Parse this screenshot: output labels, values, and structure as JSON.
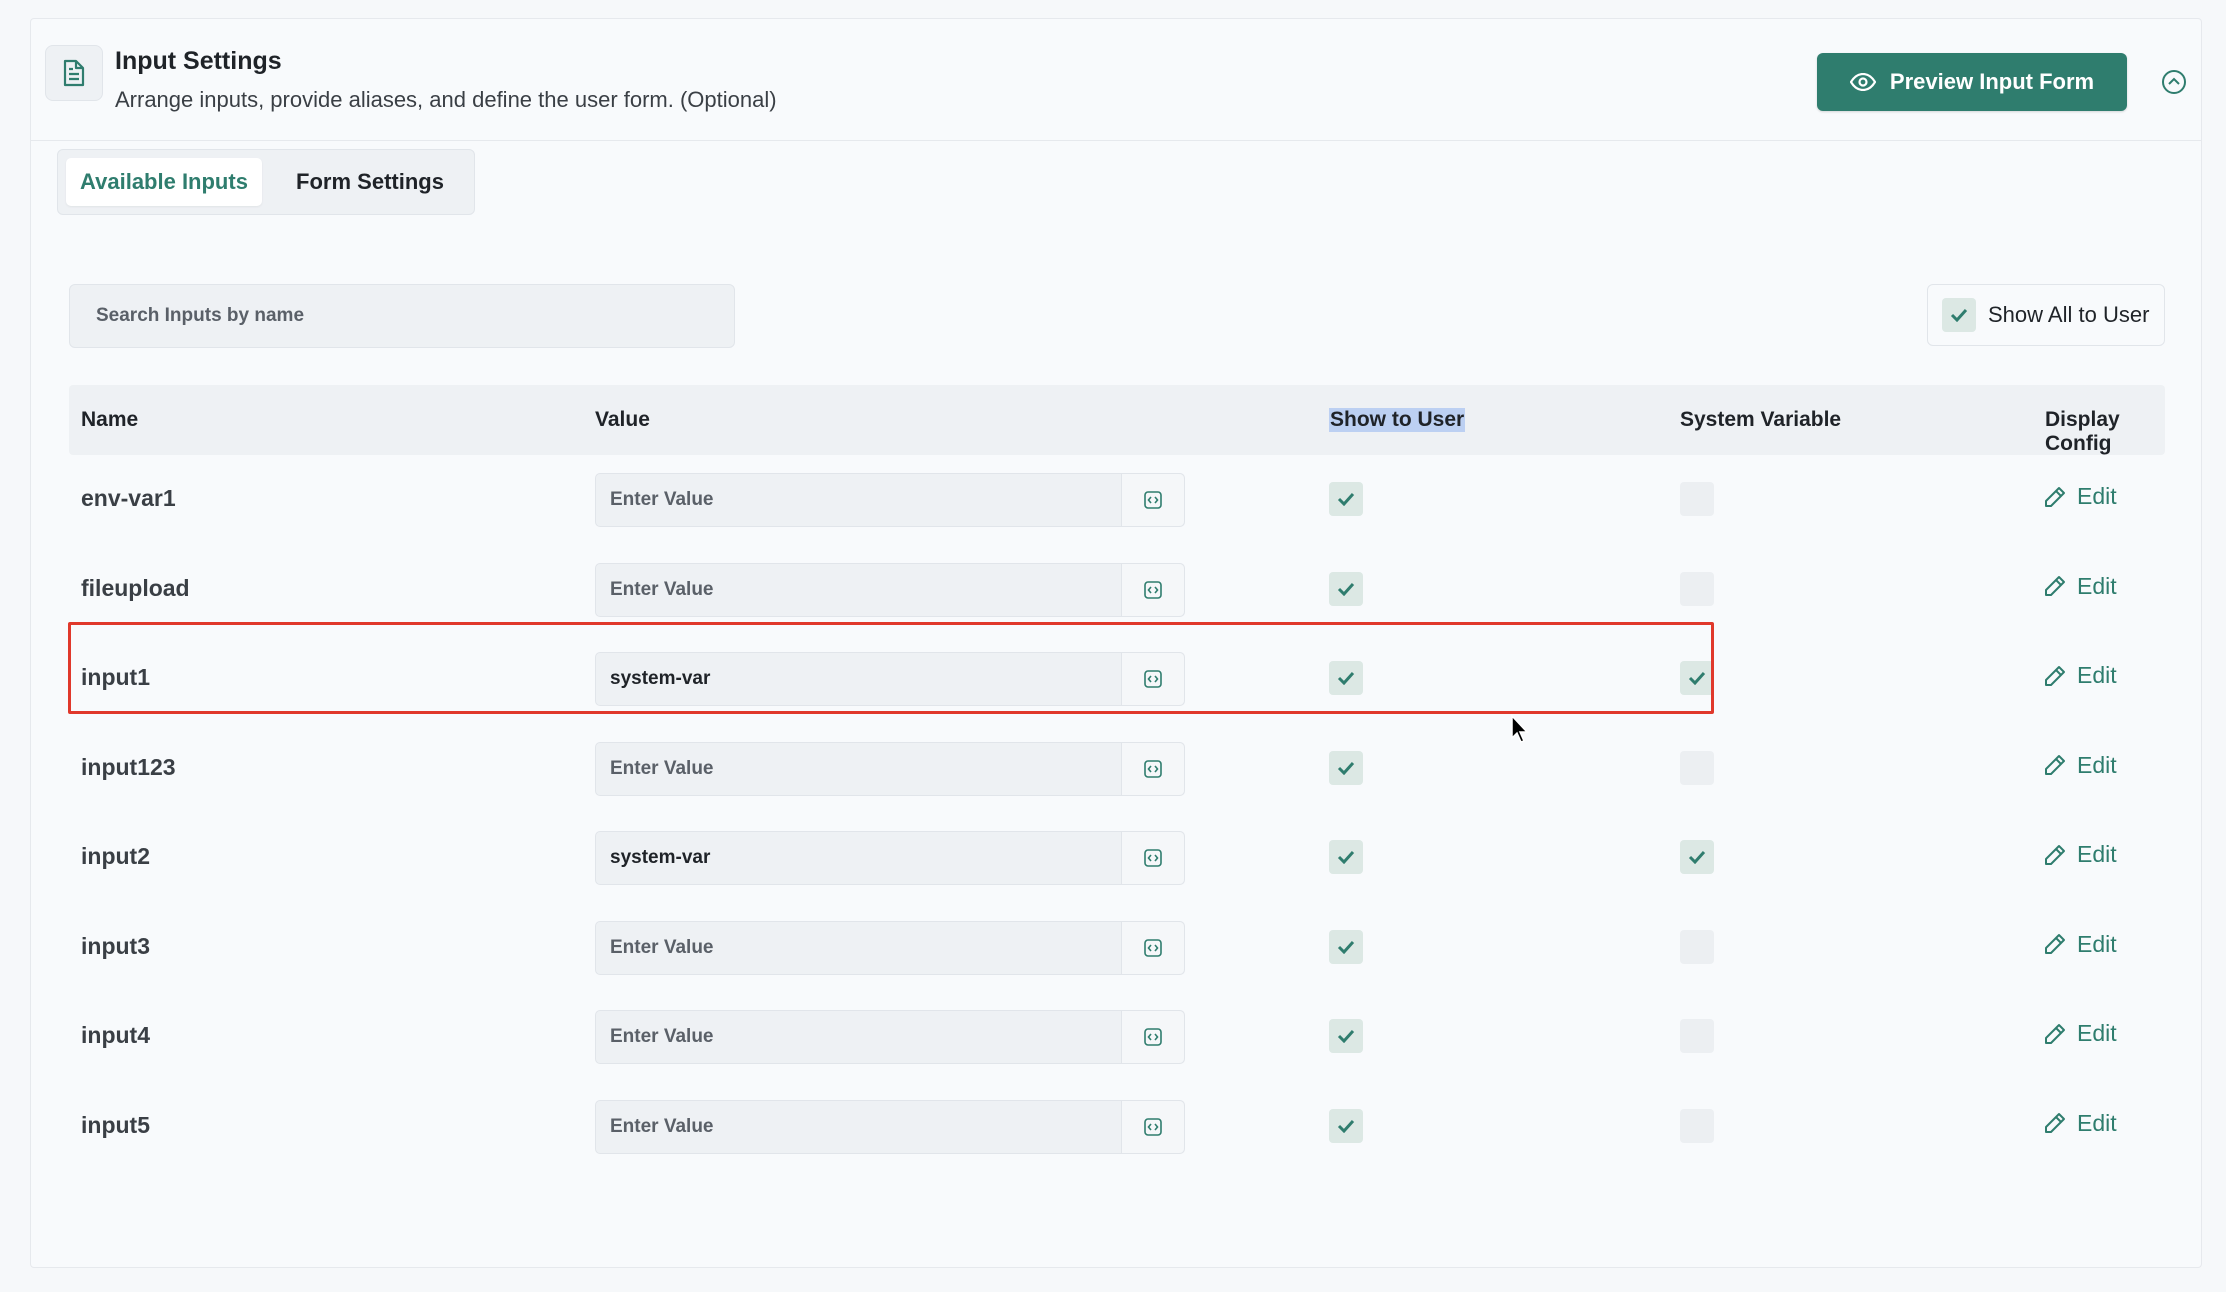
{
  "header": {
    "title": "Input Settings",
    "subtitle": "Arrange inputs, provide aliases, and define the user form. (Optional)",
    "preview_button": "Preview Input Form",
    "doc_icon": "document-icon",
    "collapse_icon": "chevron-up-circle-icon"
  },
  "tabs": [
    {
      "label": "Available Inputs",
      "active": true
    },
    {
      "label": "Form Settings",
      "active": false
    }
  ],
  "search": {
    "placeholder": "Search Inputs by name"
  },
  "show_all": {
    "label": "Show All to User",
    "checked": true
  },
  "table": {
    "columns": [
      "Name",
      "Value",
      "Show to User",
      "System Variable",
      "Display Config"
    ],
    "rows": [
      {
        "name": "env-var1",
        "value": "",
        "placeholder": "Enter Value",
        "show_to_user": true,
        "system_variable": false,
        "edit": "Edit"
      },
      {
        "name": "fileupload",
        "value": "",
        "placeholder": "Enter Value",
        "show_to_user": true,
        "system_variable": false,
        "edit": "Edit"
      },
      {
        "name": "input1",
        "value": "system-var",
        "placeholder": "Enter Value",
        "show_to_user": true,
        "system_variable": true,
        "edit": "Edit"
      },
      {
        "name": "input123",
        "value": "",
        "placeholder": "Enter Value",
        "show_to_user": true,
        "system_variable": false,
        "edit": "Edit"
      },
      {
        "name": "input2",
        "value": "system-var",
        "placeholder": "Enter Value",
        "show_to_user": true,
        "system_variable": true,
        "edit": "Edit"
      },
      {
        "name": "input3",
        "value": "",
        "placeholder": "Enter Value",
        "show_to_user": true,
        "system_variable": false,
        "edit": "Edit"
      },
      {
        "name": "input4",
        "value": "",
        "placeholder": "Enter Value",
        "show_to_user": true,
        "system_variable": false,
        "edit": "Edit"
      },
      {
        "name": "input5",
        "value": "",
        "placeholder": "Enter Value",
        "show_to_user": true,
        "system_variable": false,
        "edit": "Edit"
      }
    ]
  },
  "colors": {
    "accent": "#2f7d6e",
    "highlight_border": "#e0382b",
    "selection": "#bcd0f2"
  }
}
